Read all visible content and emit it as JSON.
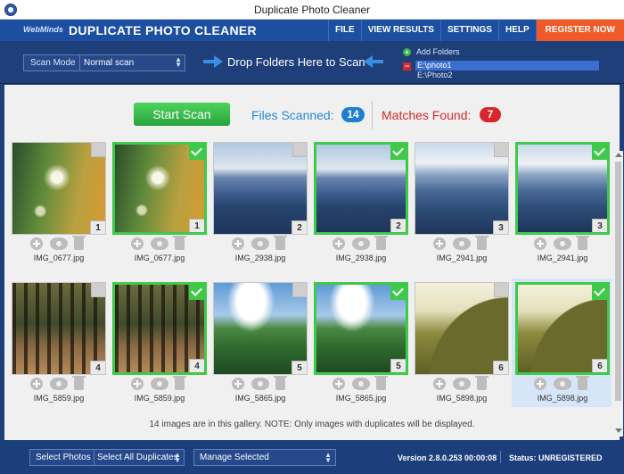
{
  "window": {
    "title": "Duplicate Photo Cleaner"
  },
  "header": {
    "logo": "WebMinds",
    "app_name": "DUPLICATE PHOTO CLEANER",
    "menu": [
      "FILE",
      "VIEW RESULTS",
      "SETTINGS",
      "HELP",
      "REGISTER NOW"
    ],
    "register_color": "#f05a28"
  },
  "toolbar": {
    "scan_mode_label": "Scan Mode",
    "scan_mode_value": "Normal scan",
    "drop_text": "Drop Folders Here to Scan",
    "add_folders_label": "Add Folders",
    "folders": [
      "E:\\photo1",
      "E:\\Photo2"
    ]
  },
  "scan": {
    "start_label": "Start Scan",
    "files_scanned_label": "Files Scanned:",
    "files_scanned_count": "14",
    "matches_label": "Matches Found:",
    "matches_count": "7"
  },
  "gallery": {
    "items": [
      {
        "name": "IMG_0677.jpg",
        "group": "1",
        "checked": false,
        "image": "dandelion-icon"
      },
      {
        "name": "IMG_0677.jpg",
        "group": "1",
        "checked": true,
        "image": "dandelion-icon"
      },
      {
        "name": "IMG_2938.jpg",
        "group": "2",
        "checked": false,
        "image": "mountain-icon"
      },
      {
        "name": "IMG_2938.jpg",
        "group": "2",
        "checked": true,
        "image": "mountain-icon"
      },
      {
        "name": "IMG_2941.jpg",
        "group": "3",
        "checked": false,
        "image": "mountain-icon"
      },
      {
        "name": "IMG_2941.jpg",
        "group": "3",
        "checked": true,
        "image": "mountain-icon"
      },
      {
        "name": "IMG_5859.jpg",
        "group": "4",
        "checked": false,
        "image": "forest-icon"
      },
      {
        "name": "IMG_5859.jpg",
        "group": "4",
        "checked": true,
        "image": "forest-icon"
      },
      {
        "name": "IMG_5865.jpg",
        "group": "5",
        "checked": false,
        "image": "green-hills-icon"
      },
      {
        "name": "IMG_5865.jpg",
        "group": "5",
        "checked": true,
        "image": "green-hills-icon"
      },
      {
        "name": "IMG_5898.jpg",
        "group": "6",
        "checked": false,
        "image": "hill-icon"
      },
      {
        "name": "IMG_5898.jpg",
        "group": "6",
        "checked": true,
        "image": "hill-icon"
      }
    ],
    "note": "14 images are in this gallery. NOTE: Only images with duplicates will be displayed."
  },
  "footer": {
    "select_photos_label": "Select Photos",
    "select_value": "Select All Duplicates",
    "manage_label": "Manage Selected",
    "version": "Version 2.8.0.253 00:00:08",
    "status_label": "Status:",
    "status_value": "UNREGISTERED"
  },
  "colors": {
    "header": "#1c4fa0",
    "toolbar": "#1e3f7a",
    "check_green": "#3ec94a",
    "files_blue": "#1e7fd1",
    "matches_red": "#d9262c"
  }
}
